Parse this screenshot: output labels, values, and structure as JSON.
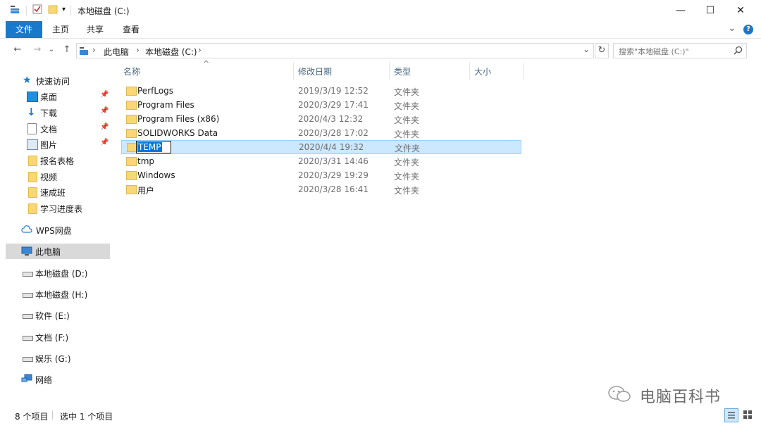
{
  "window": {
    "title": "本地磁盘 (C:)",
    "controls": {
      "minimize": "—",
      "maximize": "☐",
      "close": "✕"
    }
  },
  "ribbon": {
    "tabs": [
      "文件",
      "主页",
      "共享",
      "查看"
    ],
    "expand_glyph": "⌄",
    "help_glyph": "?"
  },
  "address": {
    "back": "←",
    "forward": "→",
    "recent": "⌄",
    "up": "↑",
    "path": [
      "此电脑",
      "本地磁盘 (C:)"
    ],
    "separator": "›",
    "dropdown": "⌄",
    "refresh": "↻"
  },
  "search": {
    "placeholder": "搜索\"本地磁盘 (C:)\""
  },
  "columns": {
    "name": "名称",
    "modified": "修改日期",
    "type": "类型",
    "size": "大小",
    "sort_glyph": "^"
  },
  "files": [
    {
      "name": "PerfLogs",
      "modified": "2019/3/19 12:52",
      "type": "文件夹"
    },
    {
      "name": "Program Files",
      "modified": "2020/3/29 17:41",
      "type": "文件夹"
    },
    {
      "name": "Program Files (x86)",
      "modified": "2020/4/3 12:32",
      "type": "文件夹"
    },
    {
      "name": "SOLIDWORKS Data",
      "modified": "2020/3/28 17:02",
      "type": "文件夹"
    },
    {
      "name": "TEMP",
      "modified": "2020/4/4 19:32",
      "type": "文件夹",
      "selected": true,
      "renaming": true
    },
    {
      "name": "tmp",
      "modified": "2020/3/31 14:46",
      "type": "文件夹"
    },
    {
      "name": "Windows",
      "modified": "2020/3/29 19:29",
      "type": "文件夹"
    },
    {
      "name": "用户",
      "modified": "2020/3/28 16:41",
      "type": "文件夹"
    }
  ],
  "nav": {
    "quick_access": "快速访问",
    "quick_items": [
      {
        "label": "桌面",
        "icon": "desktop-icon",
        "pinned": true
      },
      {
        "label": "下载",
        "icon": "download-icon",
        "pinned": true
      },
      {
        "label": "文档",
        "icon": "document-icon",
        "pinned": true
      },
      {
        "label": "图片",
        "icon": "picture-icon",
        "pinned": true
      },
      {
        "label": "报名表格",
        "icon": "folder-icon"
      },
      {
        "label": "视频",
        "icon": "folder-icon"
      },
      {
        "label": "速成班",
        "icon": "folder-icon"
      },
      {
        "label": "学习进度表",
        "icon": "folder-icon"
      }
    ],
    "wps": "WPS网盘",
    "this_pc": "此电脑",
    "drives": [
      "本地磁盘 (D:)",
      "本地磁盘 (H:)",
      "软件 (E:)",
      "文档 (F:)",
      "娱乐 (G:)"
    ],
    "network": "网络",
    "pin_glyph": "📌"
  },
  "status": {
    "count": "8 个项目",
    "selected": "选中 1 个项目"
  },
  "watermark": "电脑百科书",
  "colors": {
    "accent": "#1979ca",
    "selection": "#cce8ff",
    "selection_border": "#99d1ff",
    "folder": "#f8d775"
  }
}
